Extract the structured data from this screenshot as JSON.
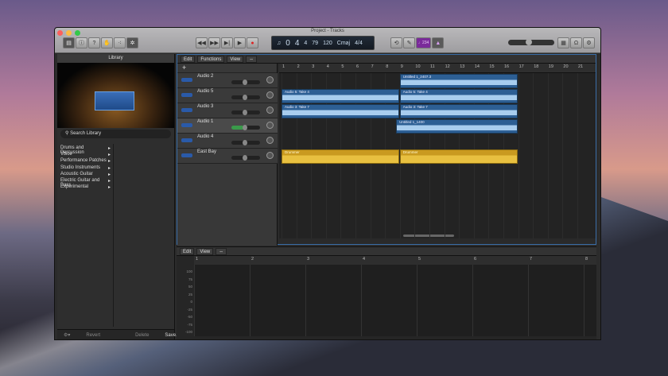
{
  "window": {
    "title": "Project - Tracks"
  },
  "toolbar": {
    "buttons": [
      "library",
      "info",
      "help",
      "smart-controls",
      "editors",
      "score"
    ],
    "transport": [
      "rewind",
      "forward",
      "to-start",
      "play",
      "record"
    ],
    "lcd": {
      "bar": "0",
      "beat": "4",
      "div": "4",
      "tick": "79",
      "tempo": "120",
      "key": "Cmaj",
      "sig": "4/4"
    },
    "tuner": "♩234",
    "right": [
      "notepad",
      "loops",
      "media"
    ]
  },
  "library": {
    "title": "Library",
    "search_placeholder": "Search Library",
    "categories": [
      "Drums and Percussion",
      "Voice",
      "Performance Patches",
      "Studio Instruments",
      "Acoustic Guitar",
      "Electric Guitar and Bass",
      "Experimental"
    ],
    "footer": {
      "revert": "Revert",
      "delete": "Delete",
      "save": "Save..."
    }
  },
  "tracks_menu": [
    "Edit",
    "Functions",
    "View"
  ],
  "ruler": [
    "1",
    "2",
    "3",
    "4",
    "5",
    "6",
    "7",
    "8",
    "9",
    "10",
    "11",
    "12",
    "13",
    "14",
    "15",
    "16",
    "17",
    "18",
    "19",
    "20",
    "21"
  ],
  "tracks": [
    {
      "name": "Audio 2"
    },
    {
      "name": "Audio 5"
    },
    {
      "name": "Audio 3"
    },
    {
      "name": "Audio 1",
      "selected": true
    },
    {
      "name": "Audio 4"
    },
    {
      "name": "East Bay"
    }
  ],
  "regions": [
    {
      "track": 0,
      "start": 9,
      "end": 17,
      "label": "Untitled 1_2407.3"
    },
    {
      "track": 1,
      "start": 1,
      "end": 9,
      "label": "Audio 5: Take 4"
    },
    {
      "track": 1,
      "start": 9,
      "end": 17,
      "label": "Audio 5: Take 4"
    },
    {
      "track": 2,
      "start": 1,
      "end": 9,
      "label": "Audio 3: Take 7"
    },
    {
      "track": 2,
      "start": 9,
      "end": 17,
      "label": "Audio 3: Take 7"
    },
    {
      "track": 3,
      "start": 8.75,
      "end": 17,
      "label": "Untitled 1_1400"
    },
    {
      "track": 5,
      "start": 1,
      "end": 9,
      "label": "Drummer",
      "drum": true
    },
    {
      "track": 5,
      "start": 9,
      "end": 17,
      "label": "Drummer",
      "drum": true
    }
  ],
  "editor": {
    "menu": [
      "Edit",
      "View"
    ],
    "ruler": [
      "1",
      "2",
      "3",
      "4",
      "5",
      "6",
      "7",
      "8"
    ],
    "y_labels": [
      "100",
      "75",
      "50",
      "25",
      "0",
      "-25",
      "-50",
      "-75",
      "-100"
    ]
  }
}
